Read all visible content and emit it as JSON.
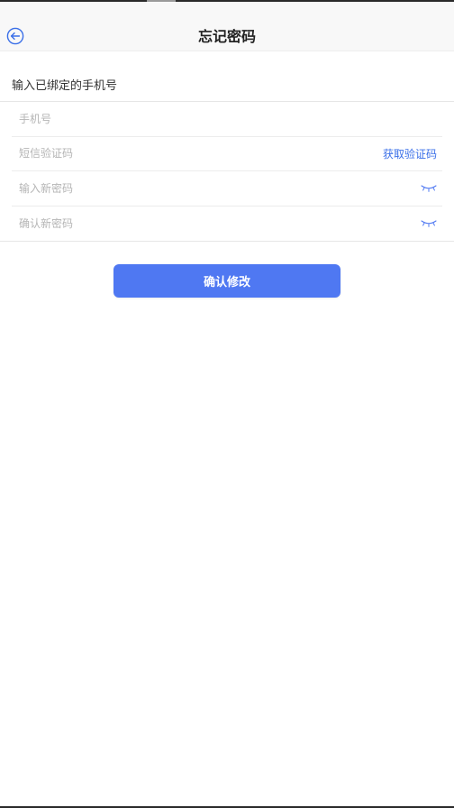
{
  "header": {
    "title": "忘记密码",
    "back_icon": "arrow-left-circle-icon"
  },
  "form": {
    "section_label": "输入已绑定的手机号",
    "phone_placeholder": "手机号",
    "sms_placeholder": "短信验证码",
    "get_code_label": "获取验证码",
    "new_password_placeholder": "输入新密码",
    "confirm_password_placeholder": "确认新密码",
    "eye_icon": "eye-closed-icon"
  },
  "actions": {
    "confirm_label": "确认修改"
  },
  "colors": {
    "accent": "#4f78f2",
    "link": "#3a6fe8"
  }
}
